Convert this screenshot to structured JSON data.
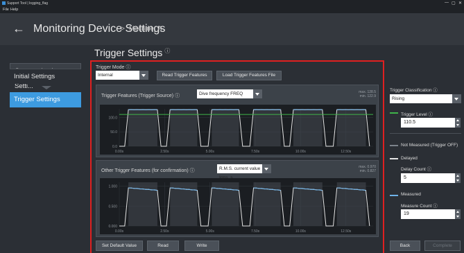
{
  "window": {
    "title": "Support Tool | logging_flag",
    "controls": [
      "—",
      "▢",
      "✕"
    ]
  },
  "menu": [
    "File",
    "Help"
  ],
  "header": {
    "back": "←",
    "title": "Monitoring Device Settings",
    "separator": ">",
    "breadcrumb": "Machine_A"
  },
  "sidebar": {
    "items": [
      {
        "label": "Communication Setti..."
      },
      {
        "label": "Initial Settings"
      },
      {
        "label": "Trigger Settings"
      }
    ]
  },
  "page": {
    "title": "Trigger Settings",
    "info": "ⓘ"
  },
  "trigger_mode": {
    "label": "Trigger Mode ⓘ",
    "value": "Internal",
    "read_button": "Read Trigger Features",
    "load_button": "Load Trigger Features File"
  },
  "panel1": {
    "label": "Trigger Features (Trigger Source) ⓘ",
    "select_value": "Dive frequency  FREQ",
    "max": "max.  128.5",
    "min": "min.  122.9",
    "y_ticks": [
      "100.0",
      "50.0",
      "0.0"
    ],
    "x_ticks": [
      "0.00s",
      "2.50s",
      "5.00s",
      "7.50s",
      "10.00s",
      "12.50s"
    ]
  },
  "panel2": {
    "label": "Other Trigger Features (for confirmation) ⓘ",
    "select_value": "R.M.S. current value  Irms_s",
    "max": "max.  0.970",
    "min": "min.  0.827",
    "y_ticks": [
      "1.000",
      "0.500",
      "0.000"
    ],
    "x_ticks": [
      "0.00s",
      "2.50s",
      "5.00s",
      "7.50s",
      "10.00s",
      "12.50s"
    ]
  },
  "right_panel": {
    "classification_label": "Trigger Classification ⓘ",
    "classification_value": "Rising",
    "trigger_level_label": "Trigger Level ⓘ",
    "trigger_level_value": "110.5",
    "not_measured_label": "Not Measured (Trigger OFF)",
    "delayed_label": "Delayed",
    "delay_count_label": "Delay Count ⓘ",
    "delay_count_value": "5",
    "measured_label": "Measured",
    "measure_count_label": "Measure Count ⓘ",
    "measure_count_value": "19"
  },
  "colors": {
    "trigger_level": "#3fb54a",
    "not_measured": "#7c838b",
    "delayed": "#e6e6e6",
    "measured": "#6fb3e8",
    "highlight": "#e02020",
    "active_nav": "#3d9be0"
  },
  "footer": {
    "set_default": "Set Default Value",
    "read": "Read",
    "write": "Write",
    "back": "Back",
    "complete": "Complete"
  },
  "chart_data": [
    {
      "type": "line",
      "name": "Dive frequency FREQ",
      "x": [
        0.0,
        0.3,
        0.5,
        2.1,
        2.3,
        2.6,
        2.8,
        4.3,
        4.5,
        4.9,
        5.1,
        6.6,
        6.8,
        7.2,
        7.4,
        8.9,
        9.1,
        9.4,
        9.6,
        11.2,
        11.4,
        11.8,
        12.0,
        13.6,
        13.8
      ],
      "y": [
        0,
        0,
        127,
        127,
        0,
        0,
        127,
        127,
        0,
        0,
        127,
        127,
        0,
        0,
        127,
        127,
        0,
        0,
        127,
        127,
        0,
        0,
        127,
        127,
        0
      ],
      "trigger_level": 110.5,
      "ylim": [
        0,
        130
      ],
      "xlim": [
        0,
        14
      ]
    },
    {
      "type": "line",
      "name": "R.M.S. current value Irms_s",
      "x": [
        0.0,
        0.3,
        0.5,
        2.1,
        2.3,
        2.6,
        2.8,
        4.3,
        4.5,
        4.9,
        5.1,
        6.6,
        6.8,
        7.2,
        7.4,
        8.9,
        9.1,
        9.4,
        9.6,
        11.2,
        11.4,
        11.8,
        12.0,
        13.6,
        13.8
      ],
      "y": [
        0,
        0,
        0.96,
        0.9,
        0,
        0,
        0.96,
        0.9,
        0,
        0,
        0.96,
        0.9,
        0,
        0,
        0.96,
        0.9,
        0,
        0,
        0.96,
        0.9,
        0,
        0,
        0.96,
        0.9,
        0
      ],
      "ylim": [
        0,
        1.1
      ],
      "xlim": [
        0,
        14
      ]
    }
  ]
}
